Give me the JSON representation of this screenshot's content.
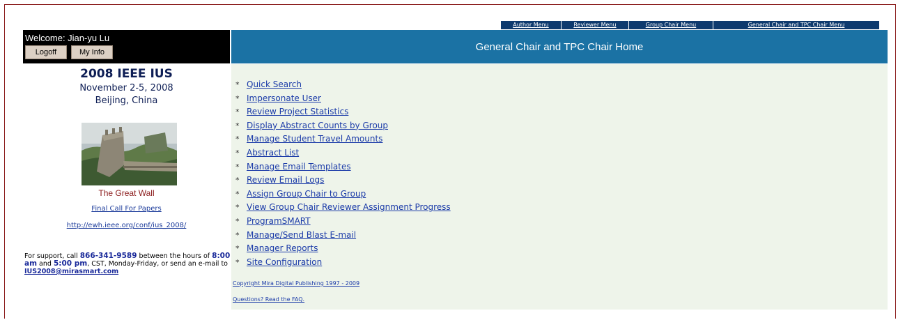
{
  "top_menu": [
    "Author Menu",
    "Reviewer Menu",
    "Group Chair Menu",
    "General Chair and TPC Chair Menu"
  ],
  "welcome": {
    "text": "Welcome: Jian-yu Lu",
    "logoff_label": "Logoff",
    "myinfo_label": "My Info"
  },
  "header": {
    "title": "General Chair and TPC Chair Home"
  },
  "conference": {
    "title": "2008 IEEE IUS",
    "dates": "November 2-5, 2008",
    "location": "Beijing, China",
    "photo_caption": "The Great Wall",
    "call_link": "Final Call For Papers",
    "url_link": "http://ewh.ieee.org/conf/ius_2008/"
  },
  "support": {
    "prefix": "For support, call ",
    "phone": "866-341-9589",
    "mid1": " between the hours of ",
    "start": "8:00 am",
    "mid2": " and ",
    "end": "5:00 pm",
    "mid3": ", CST, Monday-Friday, or send an e-mail to ",
    "email": "IUS2008@mirasmart.com"
  },
  "menu_items": [
    "Quick Search",
    "Impersonate User",
    "Review Project Statistics",
    "Display Abstract Counts by Group",
    "Manage Student Travel Amounts",
    "Abstract List",
    "Manage Email Templates",
    "Review Email Logs",
    "Assign Group Chair to Group",
    "View Group Chair Reviewer Assignment Progress",
    "ProgramSMART",
    "Manage/Send Blast E-mail",
    "Manager Reports",
    "Site Configuration"
  ],
  "bullet": "*",
  "footer": {
    "copyright": "Copyright Mira Digital Publishing 1997 - 2009",
    "faq": "Questions? Read the FAQ."
  },
  "colors": {
    "header_bar": "#1b72a4",
    "top_menu_bg": "#0e3a6e",
    "main_bg": "#eef4ea",
    "link": "#1a3aa8"
  }
}
